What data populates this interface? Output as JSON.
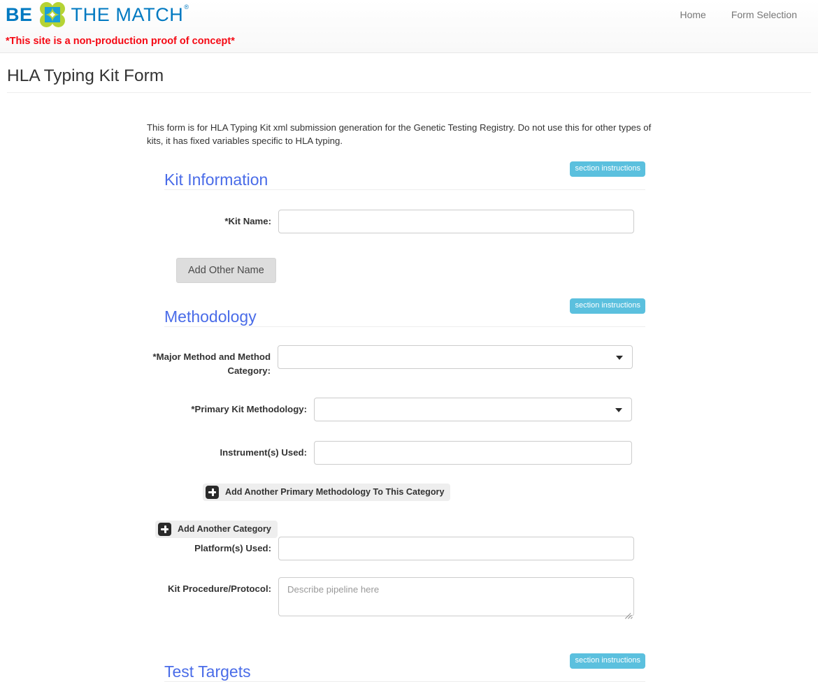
{
  "header": {
    "brand": {
      "be": "BE",
      "the_match": "THE MATCH",
      "registered": "®",
      "logo_icon": "be-the-match-flower-logo",
      "petal_color": "#b5d334",
      "center_color": "#1a9fd8",
      "text_color": "#0079c1"
    },
    "nav": [
      {
        "label": "Home",
        "name": "nav-link-home"
      },
      {
        "label": "Form Selection",
        "name": "nav-link-form-selection"
      }
    ],
    "notice": "*This site is a non-production proof of concept*",
    "notice_color": "#f50914"
  },
  "page": {
    "title": "HLA Typing Kit Form",
    "intro": "This form is for HLA Typing Kit xml submission generation for the Genetic Testing Registry. Do not use this for other types of kits, it has fixed variables specific to HLA typing."
  },
  "common": {
    "section_instructions_label": "section instructions",
    "section_instructions_color": "#5bc0de",
    "section_title_color": "#4a6ce8"
  },
  "sections": {
    "kit_information": {
      "title": "Kit Information",
      "kit_name_label": "*Kit Name:",
      "kit_name_value": "",
      "kit_name_placeholder": "",
      "add_other_name_label": "Add Other Name"
    },
    "methodology": {
      "title": "Methodology",
      "major_method_label": "*Major Method and Method Category:",
      "major_method_value": "",
      "primary_kit_methodology_label": "*Primary Kit Methodology:",
      "primary_kit_methodology_value": "",
      "instruments_used_label": "Instrument(s) Used:",
      "instruments_used_value": "",
      "instruments_used_placeholder": "",
      "add_primary_methodology_label": "Add Another Primary Methodology To This Category",
      "add_category_label": "Add Another Category",
      "platforms_used_label": "Platform(s) Used:",
      "platforms_used_value": "",
      "platforms_used_placeholder": "",
      "kit_procedure_label": "Kit Procedure/Protocol:",
      "kit_procedure_value": "",
      "kit_procedure_placeholder": "Describe pipeline here"
    },
    "test_targets": {
      "title": "Test Targets"
    }
  }
}
